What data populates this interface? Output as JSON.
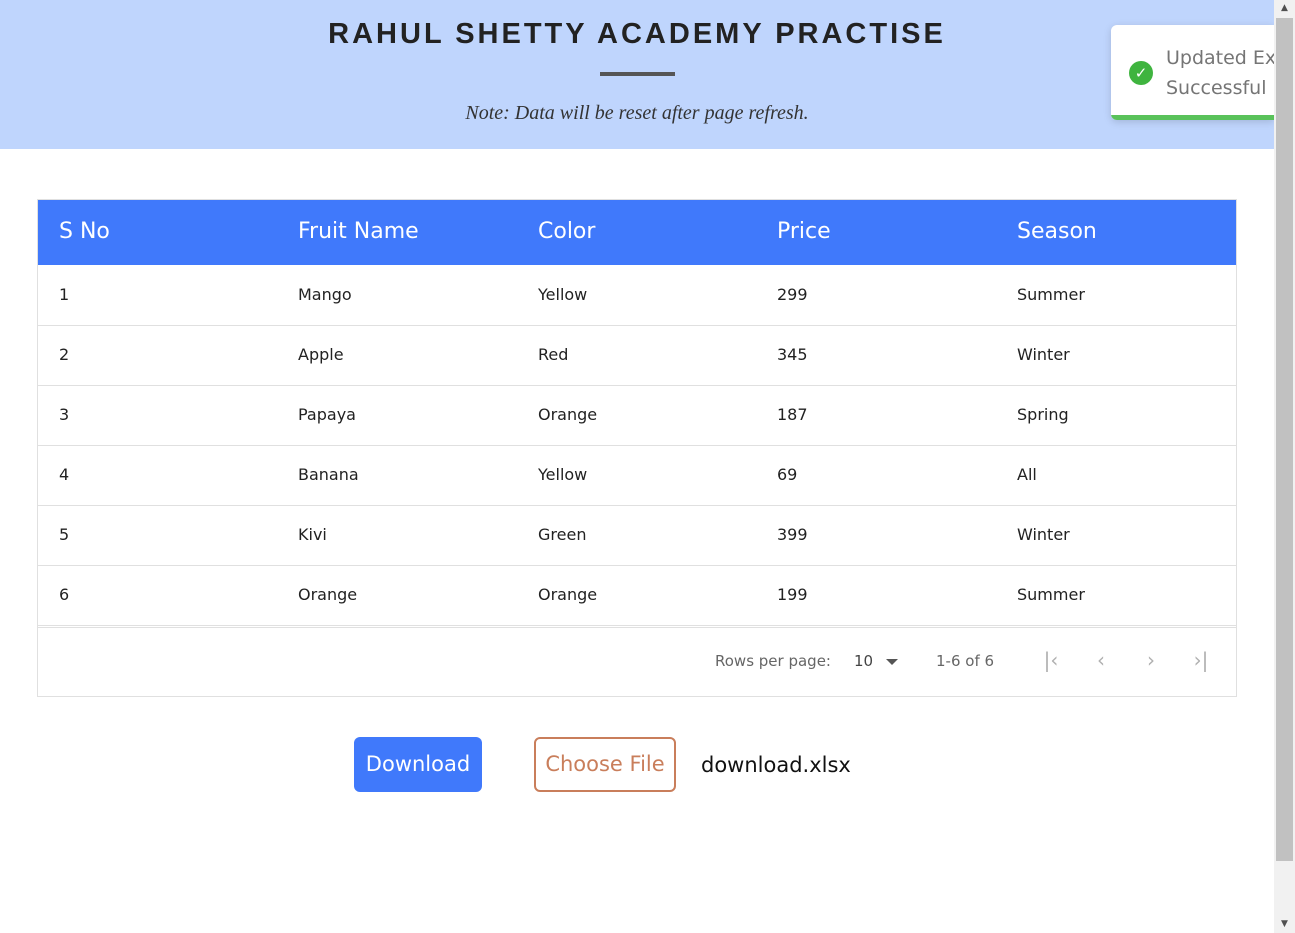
{
  "header": {
    "title": "RAHUL SHETTY ACADEMY PRACTISE",
    "note": "Note: Data will be reset after page refresh."
  },
  "toast": {
    "line1": "Updated Ex",
    "line2": "Successful",
    "icon": "check-circle-icon",
    "color": "#3fb43f"
  },
  "table": {
    "columns": [
      "S No",
      "Fruit Name",
      "Color",
      "Price",
      "Season"
    ],
    "rows": [
      [
        "1",
        "Mango",
        "Yellow",
        "299",
        "Summer"
      ],
      [
        "2",
        "Apple",
        "Red",
        "345",
        "Winter"
      ],
      [
        "3",
        "Papaya",
        "Orange",
        "187",
        "Spring"
      ],
      [
        "4",
        "Banana",
        "Yellow",
        "69",
        "All"
      ],
      [
        "5",
        "Kivi",
        "Green",
        "399",
        "Winter"
      ],
      [
        "6",
        "Orange",
        "Orange",
        "199",
        "Summer"
      ]
    ],
    "header_color": "#4079fb"
  },
  "pagination": {
    "rows_per_page_label": "Rows per page:",
    "rows_per_page_value": "10",
    "range": "1-6 of 6",
    "first_icon": "first-page-icon",
    "prev_icon": "prev-page-icon",
    "next_icon": "next-page-icon",
    "last_icon": "last-page-icon"
  },
  "actions": {
    "download_label": "Download",
    "choose_file_label": "Choose File",
    "file_name": "download.xlsx"
  }
}
